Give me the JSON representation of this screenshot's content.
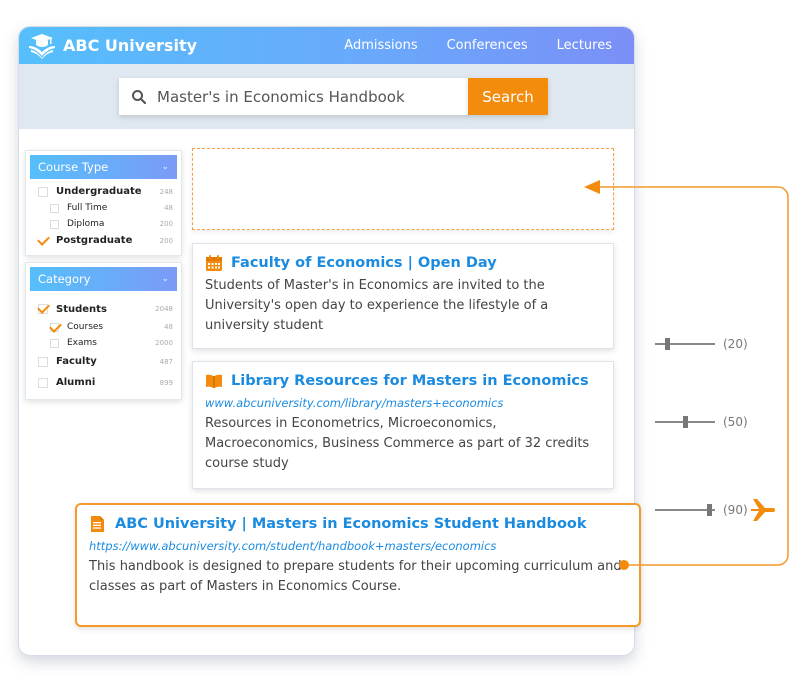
{
  "header": {
    "brand": "ABC University",
    "nav": [
      "Admissions",
      "Conferences",
      "Lectures"
    ]
  },
  "search": {
    "value": "Master's in Economics Handbook",
    "button_label": "Search"
  },
  "filters": [
    {
      "title": "Course Type",
      "items": [
        {
          "label": "Undergraduate",
          "count": "248",
          "checked": false,
          "level": 0
        },
        {
          "label": "Full Time",
          "count": "48",
          "checked": false,
          "level": 1
        },
        {
          "label": "Diploma",
          "count": "200",
          "checked": false,
          "level": 1
        },
        {
          "label": "Postgraduate",
          "count": "200",
          "checked": true,
          "level": 0
        }
      ]
    },
    {
      "title": "Category",
      "items": [
        {
          "label": "Students",
          "count": "2048",
          "checked": true,
          "level": 0
        },
        {
          "label": "Courses",
          "count": "48",
          "checked": true,
          "level": 1
        },
        {
          "label": "Exams",
          "count": "2000",
          "checked": false,
          "level": 1
        },
        {
          "label": "Faculty",
          "count": "487",
          "checked": false,
          "level": 0
        },
        {
          "label": "Alumni",
          "count": "899",
          "checked": false,
          "level": 0
        }
      ]
    }
  ],
  "results": [
    {
      "icon": "calendar-icon",
      "title": "Faculty of Economics | Open Day",
      "url": "",
      "description": "Students of Master's in Economics are invited to the University's open day to experience the lifestyle of a university student"
    },
    {
      "icon": "book-icon",
      "title": "Library Resources for Masters in Economics",
      "url": "www.abcuniversity.com/library/masters+economics",
      "description": "Resources in Econometrics, Microeconomics, Macroeconomics, Business Commerce as part of 32 credits course study"
    },
    {
      "icon": "document-icon",
      "title": "ABC University | Masters in Economics Student Handbook",
      "url": "https://www.abcuniversity.com/student/handbook+masters/economics",
      "description": "This handbook is designed to prepare students for their upcoming curriculum and classes as part of Masters in Economics Course."
    }
  ],
  "sliders": [
    {
      "value": 20,
      "label": "(20)"
    },
    {
      "value": 50,
      "label": "(50)"
    },
    {
      "value": 90,
      "label": "(90)"
    }
  ],
  "colors": {
    "accent": "#f38b0c",
    "link": "#1b8be0",
    "header_start": "#55bffb",
    "header_end": "#7b8ff7"
  }
}
